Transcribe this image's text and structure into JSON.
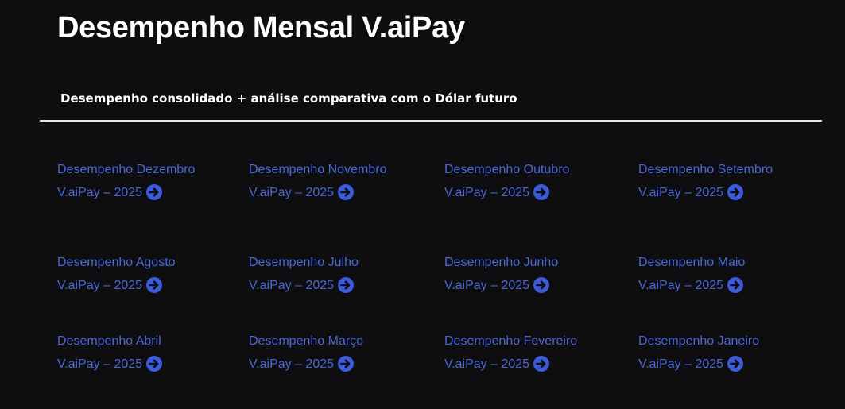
{
  "header": {
    "title": "Desempenho Mensal V.aiPay",
    "subtitle": "Desempenho consolidado + análise comparativa com o Dólar futuro"
  },
  "colors": {
    "background": "#0e0e11",
    "link": "#4a67d6",
    "arrow_icon": "#3b5bdb",
    "divider": "#e8e8e8"
  },
  "cards": [
    {
      "line1": "Desempenho Dezembro",
      "line2": "V.aiPay – 2025",
      "icon": "arrow-right-circle-icon"
    },
    {
      "line1": "Desempenho Novembro",
      "line2": "V.aiPay – 2025",
      "icon": "arrow-right-circle-icon"
    },
    {
      "line1": "Desempenho Outubro",
      "line2": "V.aiPay – 2025",
      "icon": "arrow-right-circle-icon"
    },
    {
      "line1": "Desempenho Setembro",
      "line2": "V.aiPay – 2025",
      "icon": "arrow-right-circle-icon"
    },
    {
      "line1": "Desempenho Agosto",
      "line2": "V.aiPay – 2025",
      "icon": "arrow-right-circle-icon"
    },
    {
      "line1": "Desempenho Julho",
      "line2": "V.aiPay – 2025",
      "icon": "arrow-right-circle-icon"
    },
    {
      "line1": "Desempenho Junho",
      "line2": "V.aiPay – 2025",
      "icon": "arrow-right-circle-icon"
    },
    {
      "line1": "Desempenho Maio",
      "line2": "V.aiPay – 2025",
      "icon": "arrow-right-circle-icon"
    },
    {
      "line1": "Desempenho Abril",
      "line2": "V.aiPay – 2025",
      "icon": "arrow-right-circle-icon"
    },
    {
      "line1": "Desempenho Março",
      "line2": "V.aiPay – 2025",
      "icon": "arrow-right-circle-icon"
    },
    {
      "line1": "Desempenho Fevereiro",
      "line2": "V.aiPay – 2025",
      "icon": "arrow-right-circle-icon"
    },
    {
      "line1": "Desempenho Janeiro",
      "line2": "V.aiPay – 2025",
      "icon": "arrow-right-circle-icon"
    }
  ]
}
